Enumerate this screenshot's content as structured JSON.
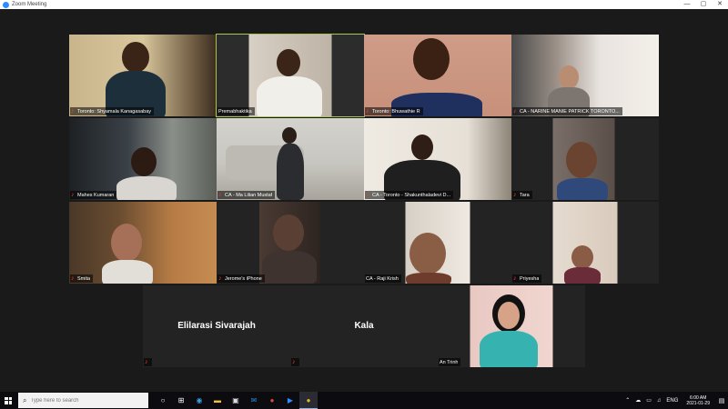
{
  "window": {
    "title": "Zoom Meeting",
    "controls": [
      "—",
      "▢",
      "✕"
    ]
  },
  "tiles": [
    {
      "id": "t1",
      "name": "Toronto: Shyamala Kanagasabay",
      "muted": true
    },
    {
      "id": "t2",
      "name": "Premabhaktika",
      "muted": false,
      "active": true
    },
    {
      "id": "t3",
      "name": "Toronto: Bhuwathie R",
      "muted": true
    },
    {
      "id": "t4",
      "name": "CA - NARINE MANIE PATRICK TORONTO...",
      "muted": true
    },
    {
      "id": "t5",
      "name": "Mahes Kumaran",
      "muted": true
    },
    {
      "id": "t6",
      "name": "CA - Ma Lilian Mustaf",
      "muted": true
    },
    {
      "id": "t7",
      "name": "CA - Toronto - Shakunthaladevi D...",
      "muted": true
    },
    {
      "id": "t8",
      "name": "Tara",
      "muted": true
    },
    {
      "id": "t9",
      "name": "Smita",
      "muted": true
    },
    {
      "id": "t10",
      "name": "Jerome's iPhone",
      "muted": true
    },
    {
      "id": "t11",
      "name": "CA - Raji Krish",
      "muted": false
    },
    {
      "id": "t12",
      "name": "Priyesha",
      "muted": true
    },
    {
      "id": "t13",
      "name": "Elilarasi Sivarajah",
      "muted": true,
      "video_off": true
    },
    {
      "id": "t14",
      "name": "Kala",
      "muted": true,
      "video_off": true
    },
    {
      "id": "t15",
      "name": "An Trinh",
      "muted": false
    }
  ],
  "taskbar": {
    "search_placeholder": "Type here to search",
    "apps": [
      "task-view",
      "edge",
      "file-explorer",
      "store",
      "mail",
      "chrome-1",
      "zoom",
      "chrome-2"
    ],
    "tray": {
      "lang": "ENG",
      "time": "6:00 AM",
      "date": "2021-01-29"
    }
  }
}
